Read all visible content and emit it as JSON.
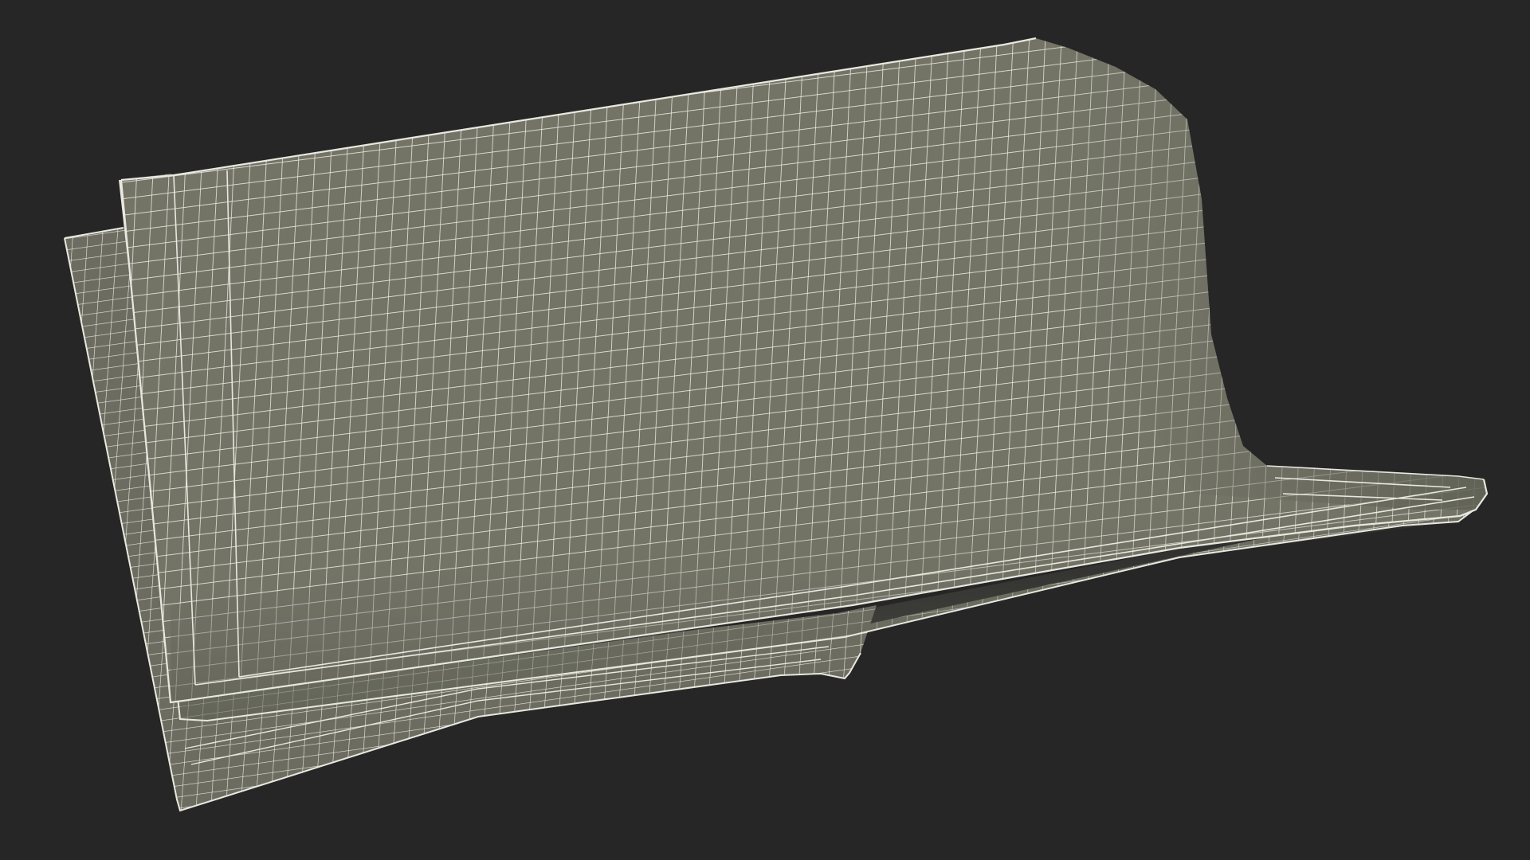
{
  "scene": {
    "subject": "folded-cloth-wireframe-render",
    "colors": {
      "background": "#262626",
      "cloth_fill": "#737466",
      "cloth_fill_under": "#6c6d60",
      "cloth_shadow": "#5f6055",
      "cloth_highlight": "#84857a",
      "wire": "#e8e8e0"
    }
  }
}
